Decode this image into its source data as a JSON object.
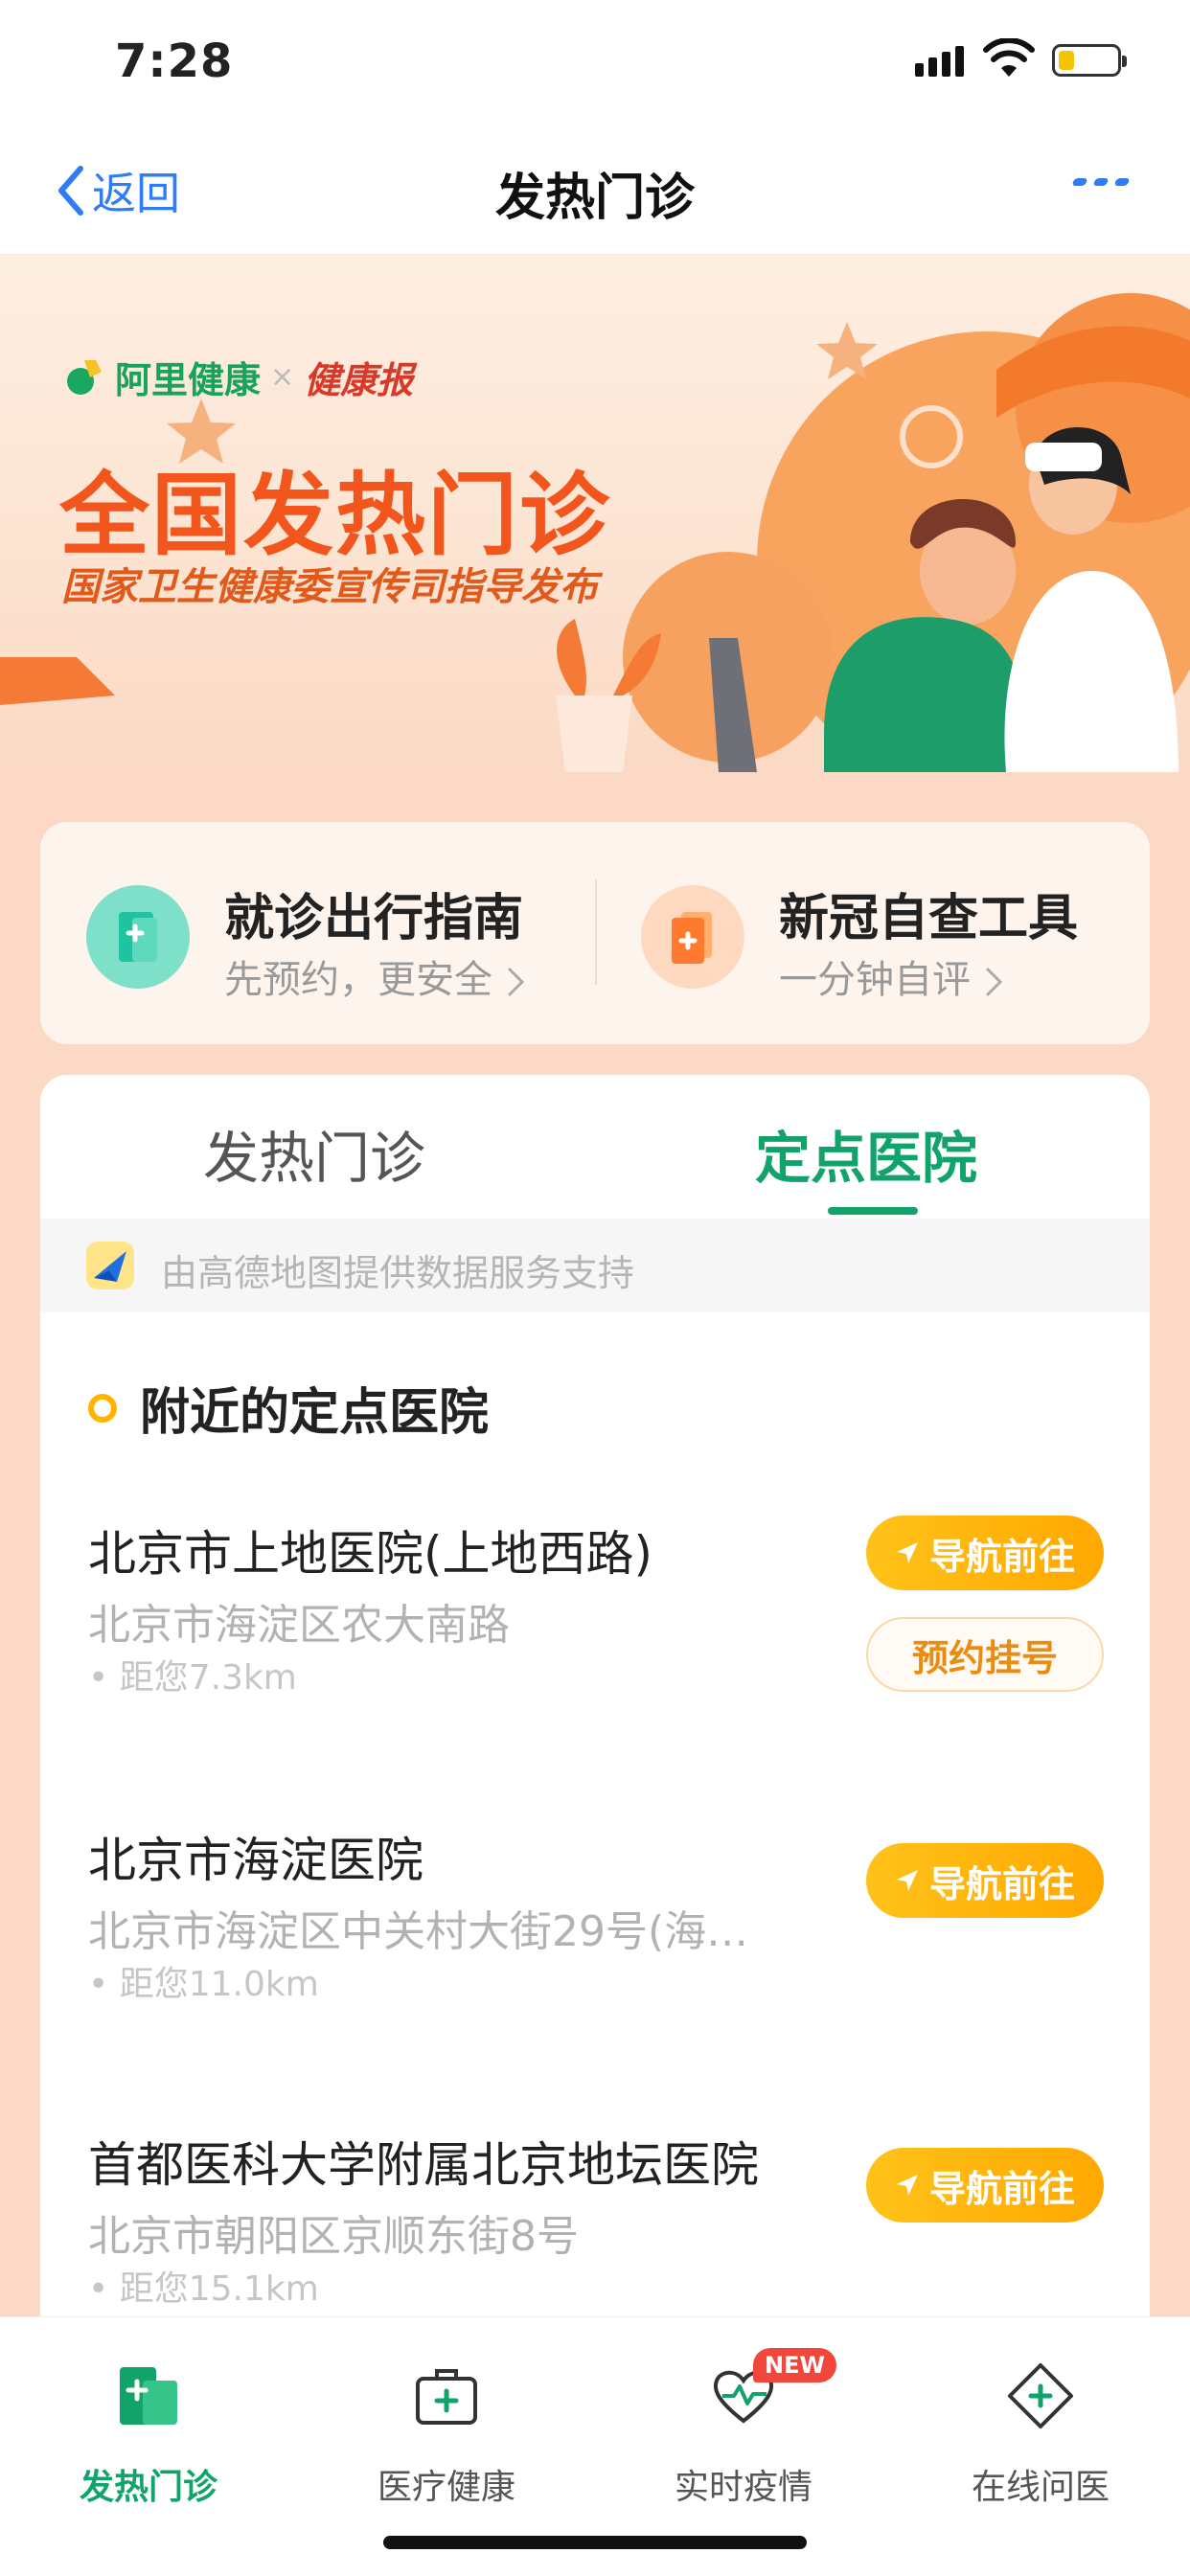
{
  "status": {
    "time": "7:28"
  },
  "nav": {
    "back_label": "返回",
    "title": "发热门诊"
  },
  "banner": {
    "brand_ali": "阿里健康",
    "brand_x": "×",
    "brand_partner": "健康报",
    "headline": "全国发热门诊",
    "subheadline": "国家卫生健康委宣传司指导发布"
  },
  "quick": [
    {
      "title": "就诊出行指南",
      "subtitle": "先预约，更安全"
    },
    {
      "title": "新冠自查工具",
      "subtitle": "一分钟自评"
    }
  ],
  "tabs": [
    "发热门诊",
    "定点医院"
  ],
  "active_tab": "定点医院",
  "provider_text": "由高德地图提供数据服务支持",
  "section_title": "附近的定点医院",
  "nav_button_label": "导航前往",
  "register_button_label": "预约挂号",
  "hospitals": [
    {
      "name": "北京市上地医院(上地西路)",
      "address": "北京市海淀区农大南路",
      "distance": "距您7.3km"
    },
    {
      "name": "北京市海淀医院",
      "address": "北京市海淀区中关村大街29号(海…",
      "distance": "距您11.0km"
    },
    {
      "name": "首都医科大学附属北京地坛医院",
      "address": "北京市朝阳区京顺东街8号",
      "distance": "距您15.1km"
    }
  ],
  "tabbar": [
    {
      "label": "发热门诊",
      "icon": "hospital-icon"
    },
    {
      "label": "医疗健康",
      "icon": "medical-kit-icon"
    },
    {
      "label": "实时疫情",
      "icon": "heart-pulse-icon",
      "badge": "NEW"
    },
    {
      "label": "在线问医",
      "icon": "diamond-plus-icon"
    }
  ],
  "colors": {
    "accent_green": "#11a36a",
    "accent_orange": "#f2561d",
    "button_yellow": "#ffb400",
    "link_blue": "#2f7cf6"
  }
}
